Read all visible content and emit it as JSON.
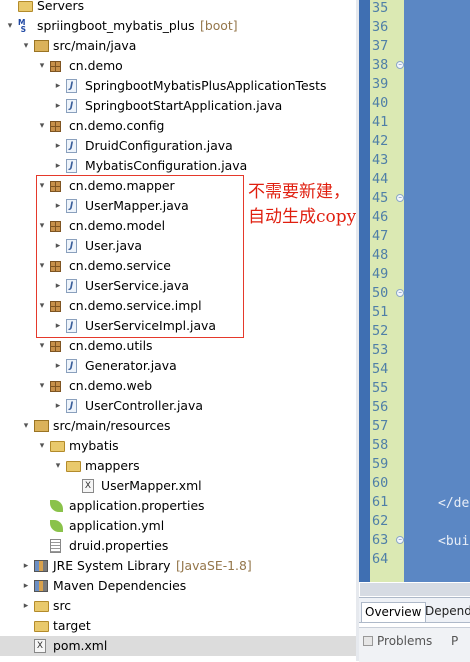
{
  "tree": {
    "items": [
      {
        "label": "Servers",
        "deco": "",
        "twisty": "",
        "icon": "folder",
        "indent": 0
      },
      {
        "label": "spriingboot_mybatis_plus",
        "deco": "[boot]",
        "twisty": "▾",
        "icon": "project",
        "indent": 0
      },
      {
        "label": "src/main/java",
        "deco": "",
        "twisty": "▾",
        "icon": "src",
        "indent": 1
      },
      {
        "label": "cn.demo",
        "deco": "",
        "twisty": "▾",
        "icon": "package",
        "indent": 2
      },
      {
        "label": "SpringbootMybatisPlusApplicationTests",
        "deco": "",
        "twisty": "▸",
        "icon": "java",
        "indent": 3
      },
      {
        "label": "SpringbootStartApplication.java",
        "deco": "",
        "twisty": "▸",
        "icon": "java",
        "indent": 3
      },
      {
        "label": "cn.demo.config",
        "deco": "",
        "twisty": "▾",
        "icon": "package",
        "indent": 2
      },
      {
        "label": "DruidConfiguration.java",
        "deco": "",
        "twisty": "▸",
        "icon": "java",
        "indent": 3
      },
      {
        "label": "MybatisConfiguration.java",
        "deco": "",
        "twisty": "▸",
        "icon": "java",
        "indent": 3
      },
      {
        "label": "cn.demo.mapper",
        "deco": "",
        "twisty": "▾",
        "icon": "package",
        "indent": 2
      },
      {
        "label": "UserMapper.java",
        "deco": "",
        "twisty": "▸",
        "icon": "java",
        "indent": 3
      },
      {
        "label": "cn.demo.model",
        "deco": "",
        "twisty": "▾",
        "icon": "package",
        "indent": 2
      },
      {
        "label": "User.java",
        "deco": "",
        "twisty": "▸",
        "icon": "java",
        "indent": 3
      },
      {
        "label": "cn.demo.service",
        "deco": "",
        "twisty": "▾",
        "icon": "package",
        "indent": 2
      },
      {
        "label": "UserService.java",
        "deco": "",
        "twisty": "▸",
        "icon": "java",
        "indent": 3
      },
      {
        "label": "cn.demo.service.impl",
        "deco": "",
        "twisty": "▾",
        "icon": "package",
        "indent": 2
      },
      {
        "label": "UserServiceImpl.java",
        "deco": "",
        "twisty": "▸",
        "icon": "java",
        "indent": 3
      },
      {
        "label": "cn.demo.utils",
        "deco": "",
        "twisty": "▾",
        "icon": "package",
        "indent": 2
      },
      {
        "label": "Generator.java",
        "deco": "",
        "twisty": "▸",
        "icon": "java",
        "indent": 3
      },
      {
        "label": "cn.demo.web",
        "deco": "",
        "twisty": "▾",
        "icon": "package",
        "indent": 2
      },
      {
        "label": "UserController.java",
        "deco": "",
        "twisty": "▸",
        "icon": "java",
        "indent": 3
      },
      {
        "label": "src/main/resources",
        "deco": "",
        "twisty": "▾",
        "icon": "src",
        "indent": 1
      },
      {
        "label": "mybatis",
        "deco": "",
        "twisty": "▾",
        "icon": "folder",
        "indent": 2
      },
      {
        "label": "mappers",
        "deco": "",
        "twisty": "▾",
        "icon": "folder",
        "indent": 3
      },
      {
        "label": "UserMapper.xml",
        "deco": "",
        "twisty": "",
        "icon": "xml",
        "indent": 4
      },
      {
        "label": "application.properties",
        "deco": "",
        "twisty": "",
        "icon": "leaf",
        "indent": 2
      },
      {
        "label": "application.yml",
        "deco": "",
        "twisty": "",
        "icon": "leaf",
        "indent": 2
      },
      {
        "label": "druid.properties",
        "deco": "",
        "twisty": "",
        "icon": "properties",
        "indent": 2
      },
      {
        "label": "JRE System Library",
        "deco": "[JavaSE-1.8]",
        "twisty": "▸",
        "icon": "library",
        "indent": 1
      },
      {
        "label": "Maven Dependencies",
        "deco": "",
        "twisty": "▸",
        "icon": "library",
        "indent": 1
      },
      {
        "label": "src",
        "deco": "",
        "twisty": "▸",
        "icon": "folder",
        "indent": 1
      },
      {
        "label": "target",
        "deco": "",
        "twisty": "",
        "icon": "folder",
        "indent": 1
      },
      {
        "label": "pom.xml",
        "deco": "",
        "twisty": "",
        "icon": "xml",
        "indent": 1
      }
    ]
  },
  "annotation": {
    "line1": "不需要新建，",
    "line2": "自动生成copy过来",
    "color": "#e01f0f"
  },
  "editor": {
    "line_numbers": [
      "35",
      "36",
      "37",
      "38",
      "39",
      "40",
      "41",
      "42",
      "43",
      "44",
      "45",
      "46",
      "47",
      "48",
      "49",
      "50",
      "51",
      "52",
      "53",
      "54",
      "55",
      "56",
      "57",
      "58",
      "59",
      "60",
      "61",
      "62",
      "63",
      "64"
    ],
    "folded_lines": [
      "38",
      "45",
      "50",
      "63"
    ],
    "code_61": "</de",
    "code_63": "<bui",
    "background": "#5b87c4",
    "gutter_color": "#dbe9b3"
  },
  "bottom_tabs": {
    "overview": "Overview",
    "dependencies": "Depend",
    "problems": "Problems",
    "next": "P"
  }
}
